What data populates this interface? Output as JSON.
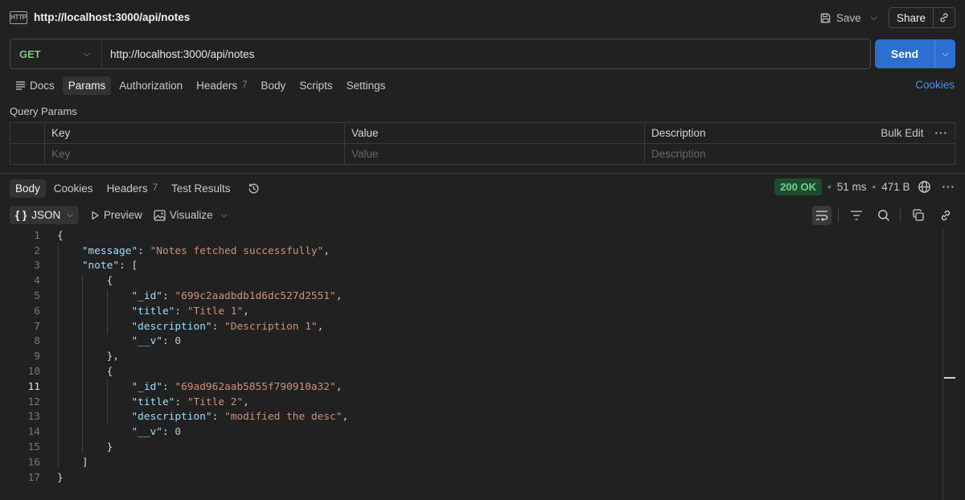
{
  "title_bar": {
    "icon": "http-icon",
    "icon_text": "HTTP",
    "title": "http://localhost:3000/api/notes",
    "save_label": "Save",
    "share_label": "Share"
  },
  "request": {
    "method": "GET",
    "url": "http://localhost:3000/api/notes",
    "send_label": "Send",
    "method_color": "#7cc47c",
    "send_color": "#2c6fd1"
  },
  "request_tabs": [
    {
      "label": "Docs"
    },
    {
      "label": "Params",
      "active": true
    },
    {
      "label": "Authorization"
    },
    {
      "label": "Headers",
      "count": "7"
    },
    {
      "label": "Body"
    },
    {
      "label": "Scripts"
    },
    {
      "label": "Settings"
    }
  ],
  "cookies_link": "Cookies",
  "query_params": {
    "title": "Query Params",
    "headers": [
      "Key",
      "Value",
      "Description"
    ],
    "bulk_edit": "Bulk Edit",
    "placeholders": [
      "Key",
      "Value",
      "Description"
    ]
  },
  "response_tabs": [
    {
      "label": "Body",
      "active": true
    },
    {
      "label": "Cookies"
    },
    {
      "label": "Headers",
      "count": "7"
    },
    {
      "label": "Test Results"
    }
  ],
  "response_meta": {
    "status": "200 OK",
    "time": "51 ms",
    "size": "471 B",
    "status_color": "#6fd38a"
  },
  "body_toolbar": {
    "format": "JSON",
    "preview": "Preview",
    "visualize": "Visualize"
  },
  "code_lines": [
    {
      "n": "1"
    },
    {
      "n": "2"
    },
    {
      "n": "3"
    },
    {
      "n": "4"
    },
    {
      "n": "5"
    },
    {
      "n": "6"
    },
    {
      "n": "7"
    },
    {
      "n": "8"
    },
    {
      "n": "9"
    },
    {
      "n": "10"
    },
    {
      "n": "11"
    },
    {
      "n": "12"
    },
    {
      "n": "13"
    },
    {
      "n": "14"
    },
    {
      "n": "15"
    },
    {
      "n": "16"
    },
    {
      "n": "17"
    }
  ],
  "response_body": {
    "message_key": "\"message\"",
    "message_value": "\"Notes fetched successfully\"",
    "note_key": "\"note\"",
    "notes": [
      {
        "id_key": "\"_id\"",
        "id": "\"699c2aadbdb1d6dc527d2551\"",
        "title_key": "\"title\"",
        "title": "\"Title 1\"",
        "desc_key": "\"description\"",
        "description": "\"Description 1\"",
        "v_key": "\"__v\"",
        "v": "0"
      },
      {
        "id_key": "\"_id\"",
        "id": "\"69ad962aab5855f790910a32\"",
        "title_key": "\"title\"",
        "title": "\"Title 2\"",
        "desc_key": "\"description\"",
        "description": "\"modified the desc\"",
        "v_key": "\"__v\"",
        "v": "0"
      }
    ]
  }
}
